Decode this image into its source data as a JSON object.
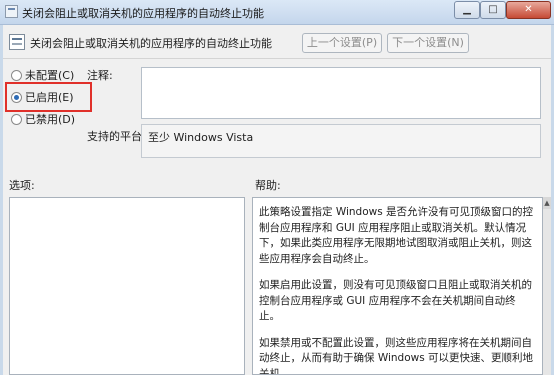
{
  "window": {
    "title": "关闭会阻止或取消关机的应用程序的自动终止功能",
    "min_glyph": "▁",
    "max_glyph": "□",
    "close_glyph": "✕"
  },
  "header": {
    "title": "关闭会阻止或取消关机的应用程序的自动终止功能",
    "prev_button": "上一个设置(P)",
    "next_button": "下一个设置(N)"
  },
  "options": {
    "not_configured": "未配置(C)",
    "enabled": "已启用(E)",
    "disabled": "已禁用(D)",
    "selected": "enabled"
  },
  "comment": {
    "label": "注释:",
    "value": ""
  },
  "platform": {
    "label": "支持的平台:",
    "value": "至少 Windows Vista"
  },
  "panels": {
    "options_label": "选项:",
    "help_label": "帮助:"
  },
  "help": {
    "paragraphs": [
      "此策略设置指定 Windows 是否允许没有可见顶级窗口的控制台应用程序和 GUI 应用程序阻止或取消关机。默认情况下，如果此类应用程序无限期地试图取消或阻止关机，则这些应用程序会自动终止。",
      "如果启用此设置，则没有可见顶级窗口且阻止或取消关机的控制台应用程序或 GUI 应用程序不会在关机期间自动终止。",
      "如果禁用或不配置此设置，则这些应用程序将在关机期间自动终止，从而有助于确保 Windows 可以更快速、更顺利地关机。"
    ]
  },
  "colors": {
    "highlight": "#e0302a",
    "radio_selected": "#2d6bb6"
  }
}
